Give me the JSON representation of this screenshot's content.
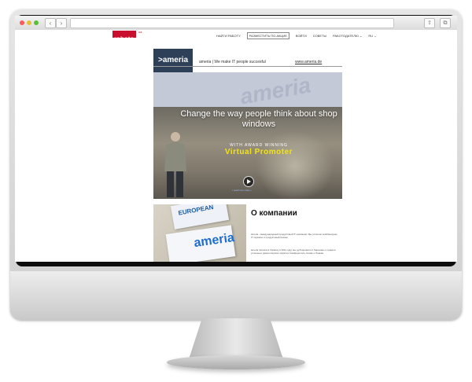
{
  "site": {
    "logo": "rabota",
    "logo_sup": "ua",
    "nav": [
      "НАЙТИ РАБОТУ",
      "РАЗМЕСТИТЬ ПО.АКЦИЕ",
      "ВОЙТИ",
      "СОВЕТЫ",
      "РАБОТОДАТЕЛЮ ⌄",
      "RU ⌄"
    ]
  },
  "company": {
    "brand": ">ameria",
    "tagline": "ameria | We make IT people succesful",
    "website": "www.ameria.de",
    "banner_watermark": "ameria"
  },
  "hero": {
    "headline": "Change the way people think about shop windows",
    "subtitle": "WITH AWARD WINNING",
    "product": "Virtual Promoter",
    "caption": "• watch the video •"
  },
  "about": {
    "title": "О компании",
    "plaque_top": "EUROPEAN",
    "plaque_bottom": "ameria",
    "text_1": "ameria - международный продуктовый IT компания. Мы успешно комбинируем IT сервисы и продуктовый бизнес.",
    "text_2": "ameria пришла в Украину в 2011 году, мы дублировали в Харькове и создали успешных девелоперских офиса в Симферополе, Киеве и Львове."
  },
  "colors": {
    "brand_red": "#c8102e",
    "brand_navy": "#2e4057",
    "accent_yellow": "#f2e318"
  },
  "icons": {
    "back": "chevron-left-icon",
    "forward": "chevron-right-icon",
    "share": "share-icon",
    "tabs": "tabs-icon"
  }
}
